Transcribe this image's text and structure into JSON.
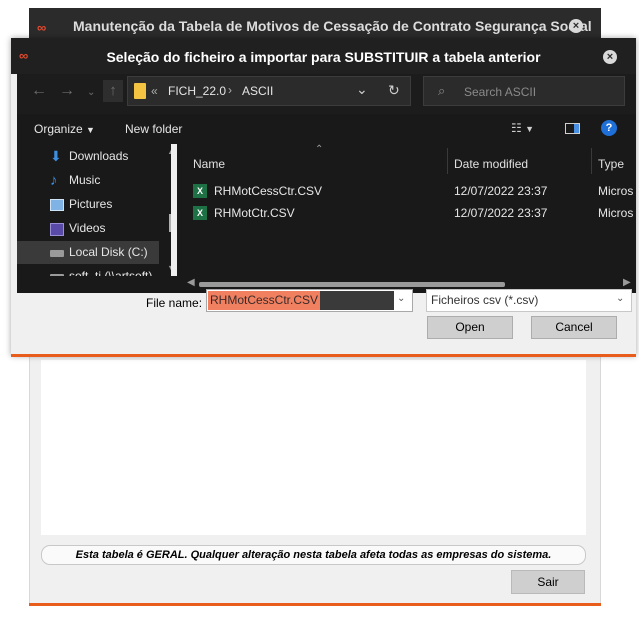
{
  "parent_window": {
    "title": "Manutenção da Tabela de Motivos de Cessação de Contrato Segurança Social",
    "close_glyph": "×",
    "note": "Esta tabela é GERAL. Qualquer alteração nesta tabela afeta todas as empresas do sistema.",
    "exit_label": "Sair"
  },
  "dialog": {
    "title": "Seleção do ficheiro a importar para SUBSTITUIR a tabela anterior",
    "close_glyph": "×",
    "address": {
      "overflow": "«",
      "path": [
        "FICH_22.0",
        "ASCII"
      ],
      "separator": "›"
    },
    "search_placeholder": "Search ASCII",
    "toolbar": {
      "organize_label": "Organize",
      "new_folder_label": "New folder"
    },
    "nav_items": [
      {
        "label": "Downloads",
        "icon": "download-arrow-icon",
        "selected": false
      },
      {
        "label": "Music",
        "icon": "music-note-icon",
        "selected": false
      },
      {
        "label": "Pictures",
        "icon": "pictures-icon",
        "selected": false
      },
      {
        "label": "Videos",
        "icon": "videos-icon",
        "selected": false
      },
      {
        "label": "Local Disk (C:)",
        "icon": "drive-icon",
        "selected": true
      },
      {
        "label": "soft_ti (\\\\artsoft)",
        "icon": "network-drive-icon",
        "selected": false
      }
    ],
    "columns": {
      "name": "Name",
      "date": "Date modified",
      "type": "Type"
    },
    "files": [
      {
        "name": "RHMotCessCtr.CSV",
        "date": "12/07/2022 23:37",
        "type": "Micros"
      },
      {
        "name": "RHMotCtr.CSV",
        "date": "12/07/2022 23:37",
        "type": "Micros"
      }
    ],
    "filename_label": "File name:",
    "filename_value": "RHMotCessCtr.CSV",
    "filetype_value": "Ficheiros csv (*.csv)",
    "open_label": "Open",
    "cancel_label": "Cancel"
  },
  "colors": {
    "accent_orange": "#e85c1c",
    "dark_bg": "#191919",
    "selection": "#f08060"
  }
}
